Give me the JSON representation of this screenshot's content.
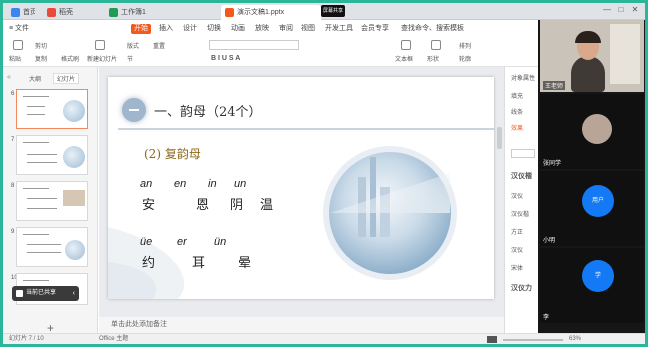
{
  "tabs": [
    {
      "label": "首页",
      "color": "#3a85f0"
    },
    {
      "label": "稻壳",
      "color": "#e84b3c"
    },
    {
      "label": "工作簿1",
      "color": "#1f9d55"
    },
    {
      "label": "演示文稿1.pptx",
      "color": "#f3581f"
    }
  ],
  "window_controls": [
    "—",
    "□",
    "✕"
  ],
  "screen_share_label": "屏幕共享中",
  "menus": [
    "≡ 文件",
    "开始",
    "插入",
    "设计",
    "切换",
    "动画",
    "放映",
    "审阅",
    "视图",
    "开发工具",
    "会员专享",
    "查找命令、搜索模板"
  ],
  "ribbon": {
    "paste": "粘贴",
    "cut": "剪切",
    "copy": "复制",
    "format_painter": "格式刷",
    "new_slide": "新建幻灯片",
    "layout": "版式",
    "section": "节",
    "reset": "重置",
    "font_buttons": "B I U S A",
    "text_box": "文本框",
    "shapes": "形状",
    "arrange": "排列",
    "outline": "轮廓"
  },
  "left_panel": {
    "tab_outline": "大纲",
    "tab_slides": "幻灯片",
    "slide_numbers": [
      "6",
      "7",
      "8",
      "9",
      "10"
    ],
    "toast": "当前已共享"
  },
  "slide": {
    "heading": "一、韵母（24个）",
    "subheading": "(2) 复韵母",
    "row1_pinyin": [
      "an",
      "en",
      "in",
      "un"
    ],
    "row1_hanzi": [
      "安",
      "恩",
      "阴",
      "温"
    ],
    "row2_pinyin": [
      "üe",
      "er",
      "ün"
    ],
    "row2_hanzi": [
      "约",
      "耳",
      "晕"
    ]
  },
  "notes_placeholder": "单击此处添加备注",
  "right_panel": [
    "对象属性",
    "填充",
    "线条",
    "效果",
    "汉仪楷",
    "汉仪",
    "汉仪楷",
    "方正",
    "汉仪",
    "宋体",
    "汉仪力"
  ],
  "video": {
    "tiles": [
      {
        "name": "王老师",
        "type": "camera"
      },
      {
        "name": "张同学",
        "type": "photo"
      },
      {
        "name": "小明",
        "avatar": "用户",
        "type": "avatar"
      },
      {
        "name": "李",
        "avatar": "学",
        "type": "avatar"
      }
    ]
  },
  "status": {
    "page": "幻灯片 7 / 10",
    "theme": "Office 主题",
    "zoom": "63%"
  }
}
